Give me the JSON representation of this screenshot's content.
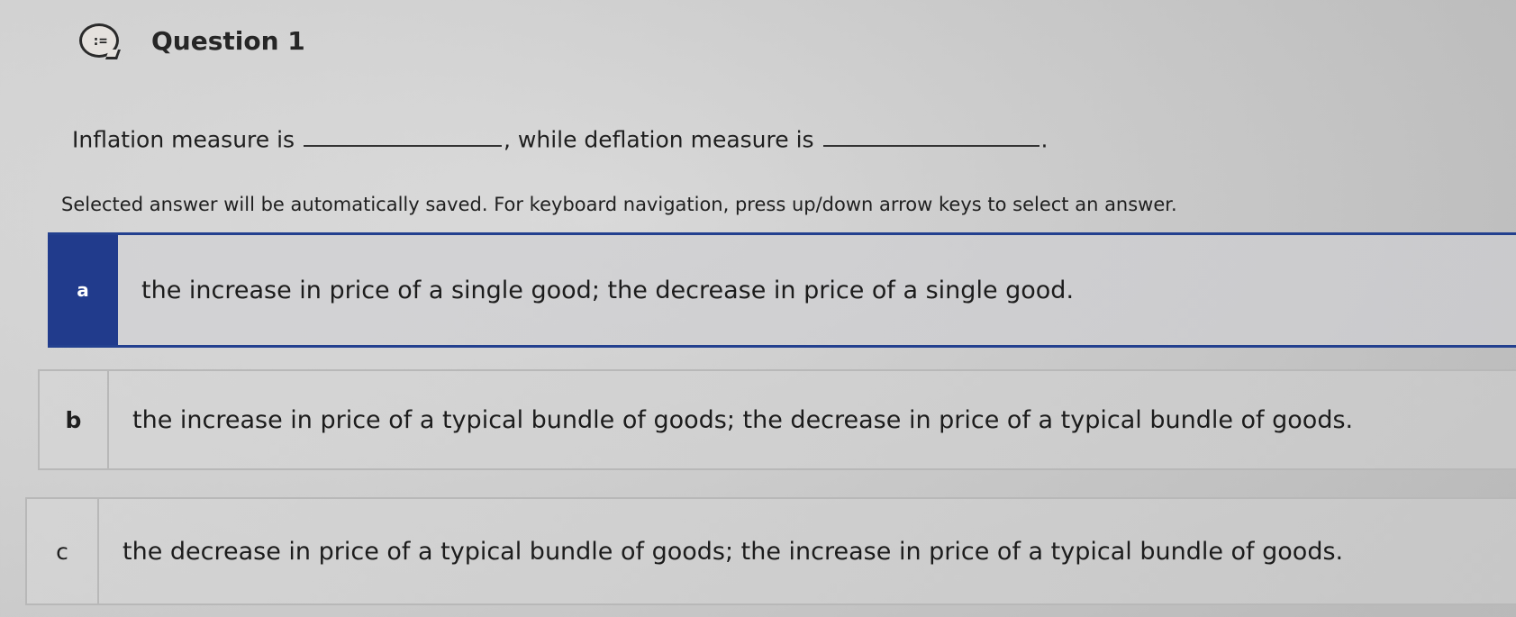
{
  "question": {
    "icon": "list-bubble-icon",
    "icon_glyph": ":=",
    "title": "Question 1"
  },
  "stem": {
    "part1": "Inflation measure is ",
    "part2": ", while deflation measure is ",
    "part3": "."
  },
  "instruction": "Selected answer will be automatically saved. For keyboard navigation, press up/down arrow keys to select an answer.",
  "options": [
    {
      "letter": "a",
      "text": "the increase in price of a single good; the decrease in price of a single good.",
      "selected": true
    },
    {
      "letter": "b",
      "text": "the increase in price of a typical bundle of goods; the decrease in price of a typical bundle of goods.",
      "selected": false
    },
    {
      "letter": "c",
      "text": "the decrease in price of a typical bundle of goods; the increase in price of a typical bundle of goods.",
      "selected": false
    }
  ],
  "colors": {
    "selected_accent": "#213b8c",
    "background": "#d4d4d4"
  }
}
